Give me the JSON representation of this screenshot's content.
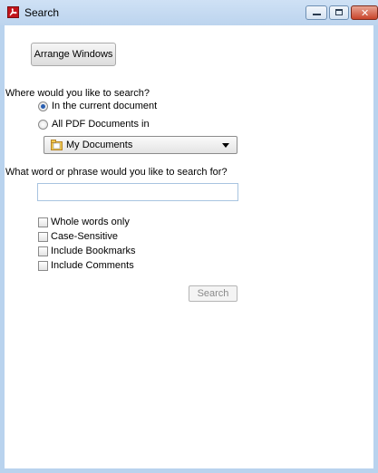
{
  "window": {
    "title": "Search",
    "icon": "adobe-acrobat-icon"
  },
  "toolbar": {
    "arrange_label": "Arrange Windows"
  },
  "where": {
    "question": "Where would you like to search?",
    "options": [
      {
        "label": "In the current document",
        "selected": true
      },
      {
        "label": "All PDF Documents in",
        "selected": false
      }
    ],
    "location_selected": "My Documents"
  },
  "what": {
    "question": "What word or phrase would you like to search for?",
    "value": ""
  },
  "options": [
    {
      "label": "Whole words only",
      "checked": false
    },
    {
      "label": "Case-Sensitive",
      "checked": false
    },
    {
      "label": "Include Bookmarks",
      "checked": false
    },
    {
      "label": "Include Comments",
      "checked": false
    }
  ],
  "search_button": "Search",
  "colors": {
    "accent": "#2a5fb0",
    "frame": "#b9d3ee",
    "close": "#c9452b"
  }
}
